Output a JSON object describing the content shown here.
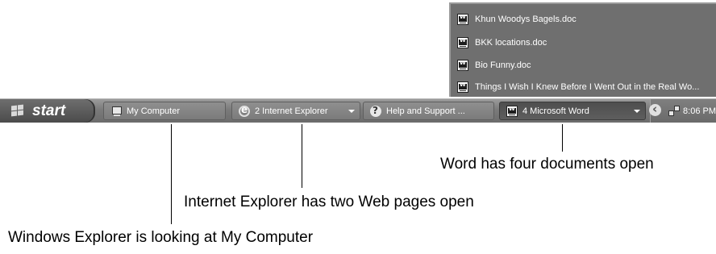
{
  "popup": {
    "items": [
      {
        "label": "Khun Woodys Bagels.doc",
        "icon": "word-document-icon"
      },
      {
        "label": "BKK locations.doc",
        "icon": "word-document-icon"
      },
      {
        "label": "Bio Funny.doc",
        "icon": "word-document-icon"
      },
      {
        "label": "Things I Wish I Knew Before I Went Out in the Real Wo...",
        "icon": "word-document-icon"
      }
    ]
  },
  "taskbar": {
    "start_label": "start",
    "buttons": [
      {
        "label": "My Computer",
        "icon": "my-computer-icon"
      },
      {
        "label": "2 Internet Explorer",
        "icon": "internet-explorer-icon"
      },
      {
        "label": "Help and Support ...",
        "icon": "help-icon"
      },
      {
        "label": "4 Microsoft Word",
        "icon": "word-icon"
      }
    ],
    "clock": "8:06 PM"
  },
  "callouts": {
    "word": "Word has four documents open",
    "ie": "Internet Explorer has two Web pages open",
    "explorer": "Windows Explorer is looking at My Computer"
  },
  "colors": {
    "taskbar": "#7a7a7a",
    "popup": "#6f6f6f",
    "text_light": "#ffffff"
  }
}
